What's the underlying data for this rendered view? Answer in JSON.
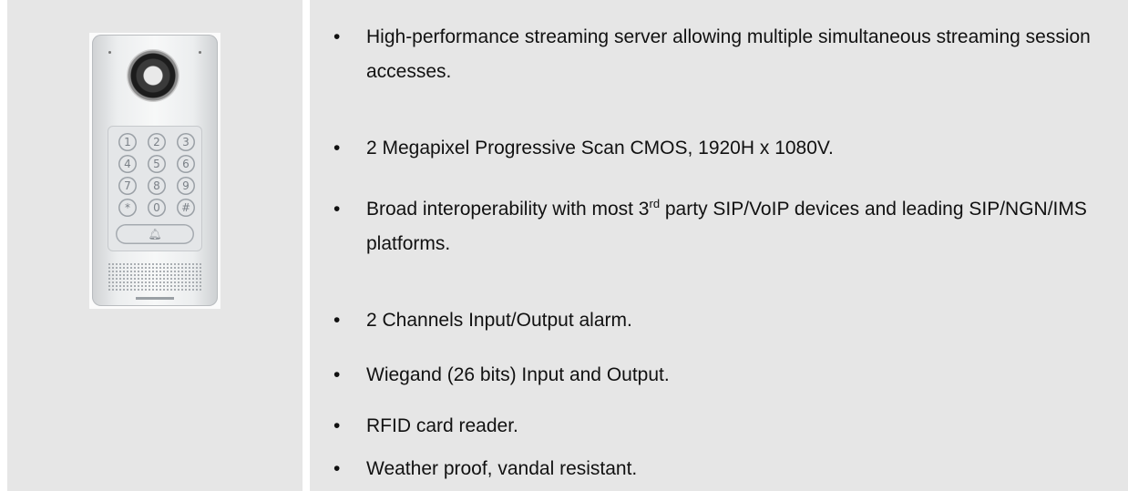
{
  "device": {
    "keys": [
      "1",
      "2",
      "3",
      "4",
      "5",
      "6",
      "7",
      "8",
      "9",
      "*",
      "0",
      "#"
    ],
    "icon": "bell-icon"
  },
  "features": [
    {
      "text": "High-performance streaming server allowing multiple simultaneous streaming session accesses."
    },
    {
      "text": "2 Megapixel Progressive Scan CMOS, 1920H x 1080V."
    },
    {
      "before": "Broad interoperability with most 3",
      "sup": "rd",
      "after": " party SIP/VoIP devices and leading SIP/NGN/IMS platforms."
    },
    {
      "text": "2 Channels Input/Output alarm."
    },
    {
      "text": "Wiegand (26 bits) Input and Output."
    },
    {
      "text": "RFID card reader."
    },
    {
      "text": "Weather proof, vandal resistant."
    }
  ]
}
